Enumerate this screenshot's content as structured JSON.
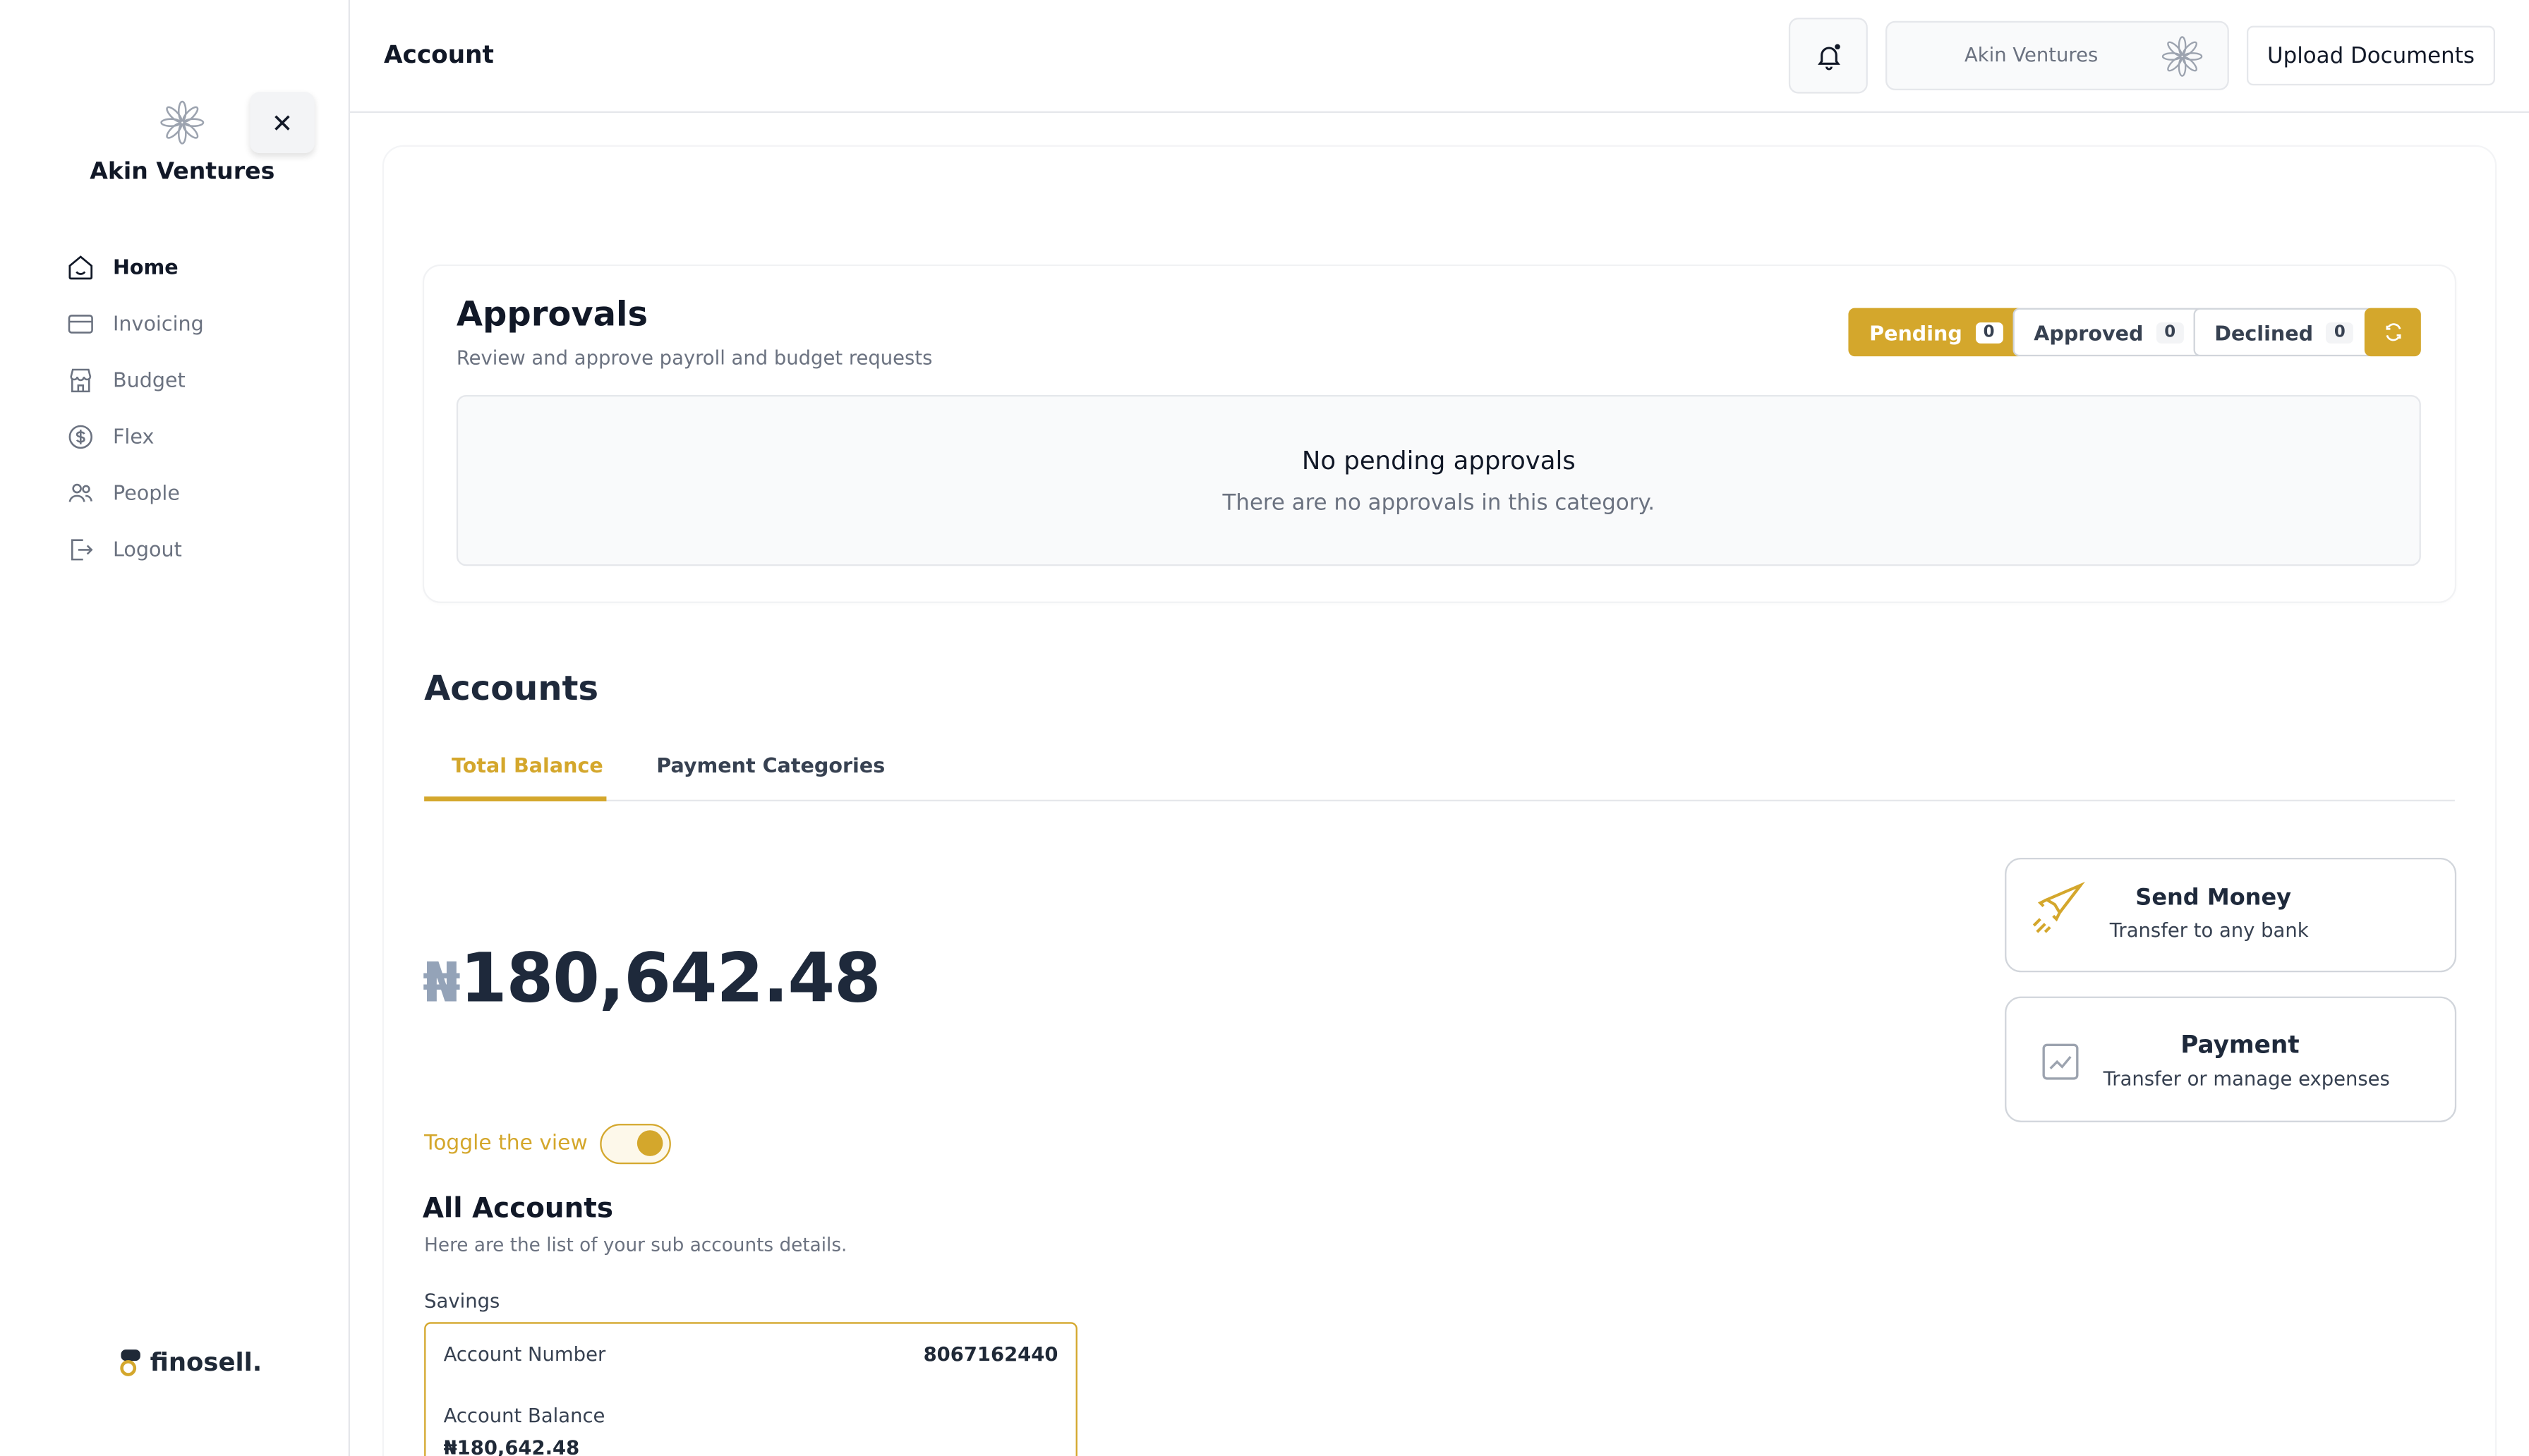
{
  "sidebar": {
    "org_name": "Akin Ventures",
    "close_icon": "close-icon",
    "items": [
      {
        "label": "Home",
        "icon": "home-icon",
        "active": true
      },
      {
        "label": "Invoicing",
        "icon": "credit-card-icon",
        "active": false
      },
      {
        "label": "Budget",
        "icon": "storefront-icon",
        "active": false
      },
      {
        "label": "Flex",
        "icon": "dollar-circle-icon",
        "active": false
      },
      {
        "label": "People",
        "icon": "people-icon",
        "active": false
      },
      {
        "label": "Logout",
        "icon": "logout-icon",
        "active": false
      }
    ],
    "brand": "finosell."
  },
  "header": {
    "title": "Account",
    "org_chip": "Akin Ventures",
    "upload_label": "Upload Documents",
    "bell_icon": "bell-icon"
  },
  "approvals": {
    "title": "Approvals",
    "subtitle": "Review and approve payroll and budget requests",
    "filters": [
      {
        "label": "Pending",
        "count": "0",
        "active": true
      },
      {
        "label": "Approved",
        "count": "0",
        "active": false
      },
      {
        "label": "Declined",
        "count": "0",
        "active": false
      }
    ],
    "empty_title": "No pending approvals",
    "empty_desc": "There are no approvals in this category."
  },
  "accounts": {
    "title": "Accounts",
    "tabs": [
      "Total Balance",
      "Payment Categories"
    ],
    "active_tab": "Total Balance",
    "balance_currency": "₦",
    "balance_amount": "180,642.48",
    "toggle_label": "Toggle the view",
    "toggle_on": true,
    "actions": [
      {
        "title": "Send Money",
        "subtitle": "Transfer to any bank",
        "icon": "rocket-icon"
      },
      {
        "title": "Payment",
        "subtitle": "Transfer or manage expenses",
        "icon": "chart-icon"
      }
    ],
    "all_title": "All Accounts",
    "all_subtitle": "Here are the list of your sub accounts details.",
    "sub_accounts": [
      {
        "type": "Savings",
        "number_label": "Account Number",
        "number": "8067162440",
        "balance_label": "Account Balance",
        "balance": "₦180,642.48"
      }
    ]
  },
  "colors": {
    "accent": "#d4a72c",
    "text": "#1e293b",
    "muted": "#6b7280"
  }
}
